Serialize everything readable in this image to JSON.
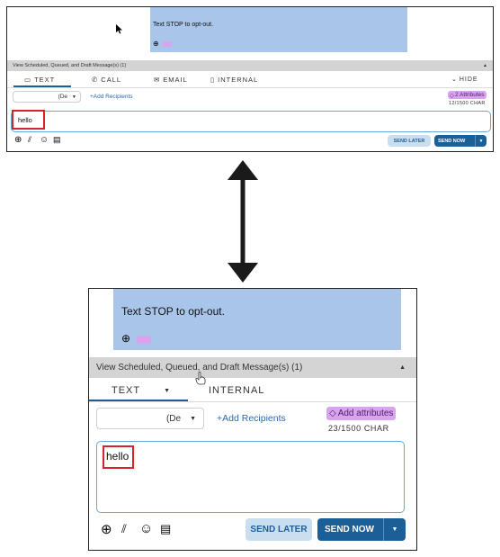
{
  "top": {
    "bubble": {
      "text": "Text STOP to opt-out."
    },
    "scheduled_bar": "View Scheduled, Queued, and Draft Message(s) (1)",
    "tabs": {
      "text": "TEXT",
      "call": "CALL",
      "email": "EMAIL",
      "internal": "INTERNAL",
      "hide": "HIDE"
    },
    "select_value": "(De",
    "add_recipients": "+Add Recipients",
    "attributes": "2 Attributes",
    "char_count": "12/1500 CHAR",
    "message": "hello",
    "send_later": "SEND LATER",
    "send_now": "SEND NOW"
  },
  "bottom": {
    "bubble": {
      "text": "Text STOP to opt-out."
    },
    "scheduled_bar": "View Scheduled, Queued, and Draft Message(s) (1)",
    "tabs": {
      "text": "TEXT",
      "internal": "INTERNAL"
    },
    "select_value": "(De",
    "add_recipients": "+Add Recipients",
    "attributes": "Add attributes",
    "char_count": "23/1500 CHAR",
    "message": "hello",
    "send_later": "SEND LATER",
    "send_now": "SEND NOW"
  },
  "colors": {
    "accent": "#1c5f96",
    "bubble": "#a9c6ea",
    "highlight": "#d6222a",
    "tag": "#d9a3f0"
  }
}
